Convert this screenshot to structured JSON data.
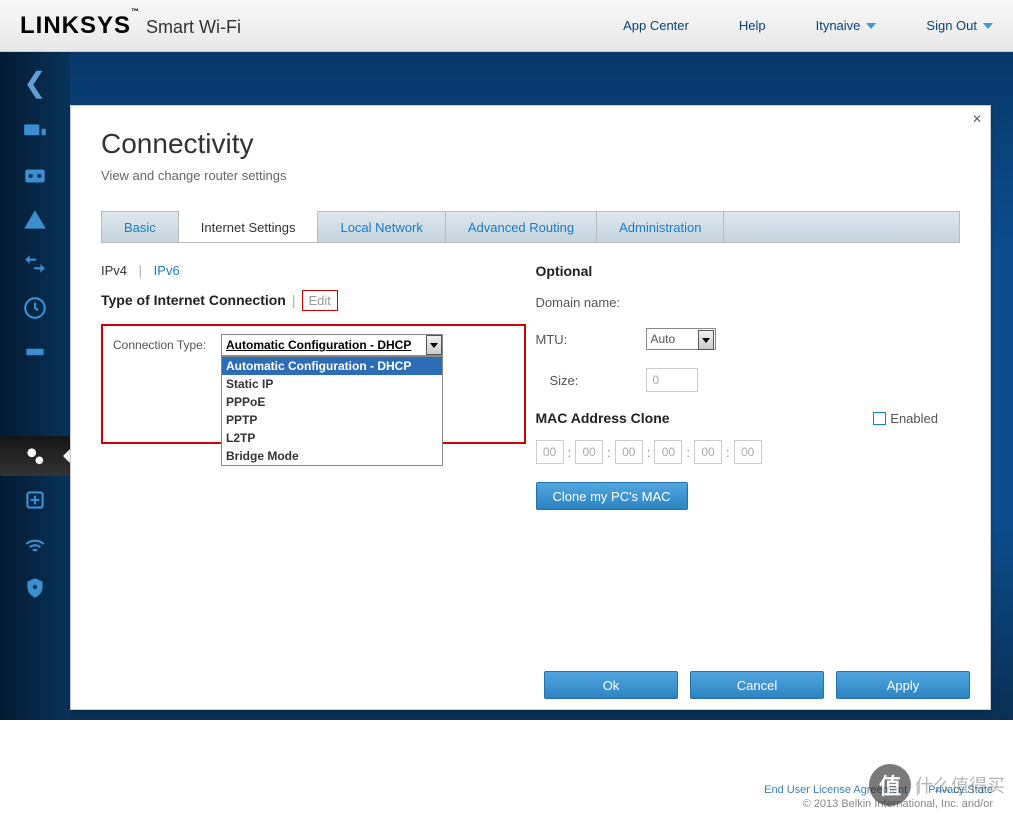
{
  "header": {
    "logo": "LINKSYS",
    "logo_sub": "Smart Wi-Fi",
    "links": {
      "app_center": "App Center",
      "help": "Help",
      "user": "Itynaive",
      "signout": "Sign Out"
    }
  },
  "page": {
    "title": "Connectivity",
    "subtitle": "View and change router settings"
  },
  "tabs": [
    "Basic",
    "Internet Settings",
    "Local Network",
    "Advanced Routing",
    "Administration"
  ],
  "subtabs": {
    "ipv4": "IPv4",
    "ipv6": "IPv6"
  },
  "left": {
    "section": "Type of Internet Connection",
    "edit": "Edit",
    "field_label": "Connection Type:",
    "selected": "Automatic Configuration - DHCP",
    "options": [
      "Automatic Configuration - DHCP",
      "Static IP",
      "PPPoE",
      "PPTP",
      "L2TP",
      "Bridge Mode"
    ]
  },
  "right": {
    "section": "Optional",
    "domain_label": "Domain name:",
    "mtu_label": "MTU:",
    "mtu_value": "Auto",
    "size_label": "Size:",
    "size_value": "0",
    "mac_title": "MAC Address Clone",
    "enabled": "Enabled",
    "mac": [
      "00",
      "00",
      "00",
      "00",
      "00",
      "00"
    ],
    "clone_btn": "Clone my PC's MAC"
  },
  "buttons": {
    "ok": "Ok",
    "cancel": "Cancel",
    "apply": "Apply"
  },
  "footer": {
    "eula": "End User License Agreement",
    "privacy": "Privacy State",
    "copyright": "© 2013 Belkin International, Inc. and/or"
  },
  "watermark": {
    "char": "值",
    "text": "什么值得买"
  }
}
